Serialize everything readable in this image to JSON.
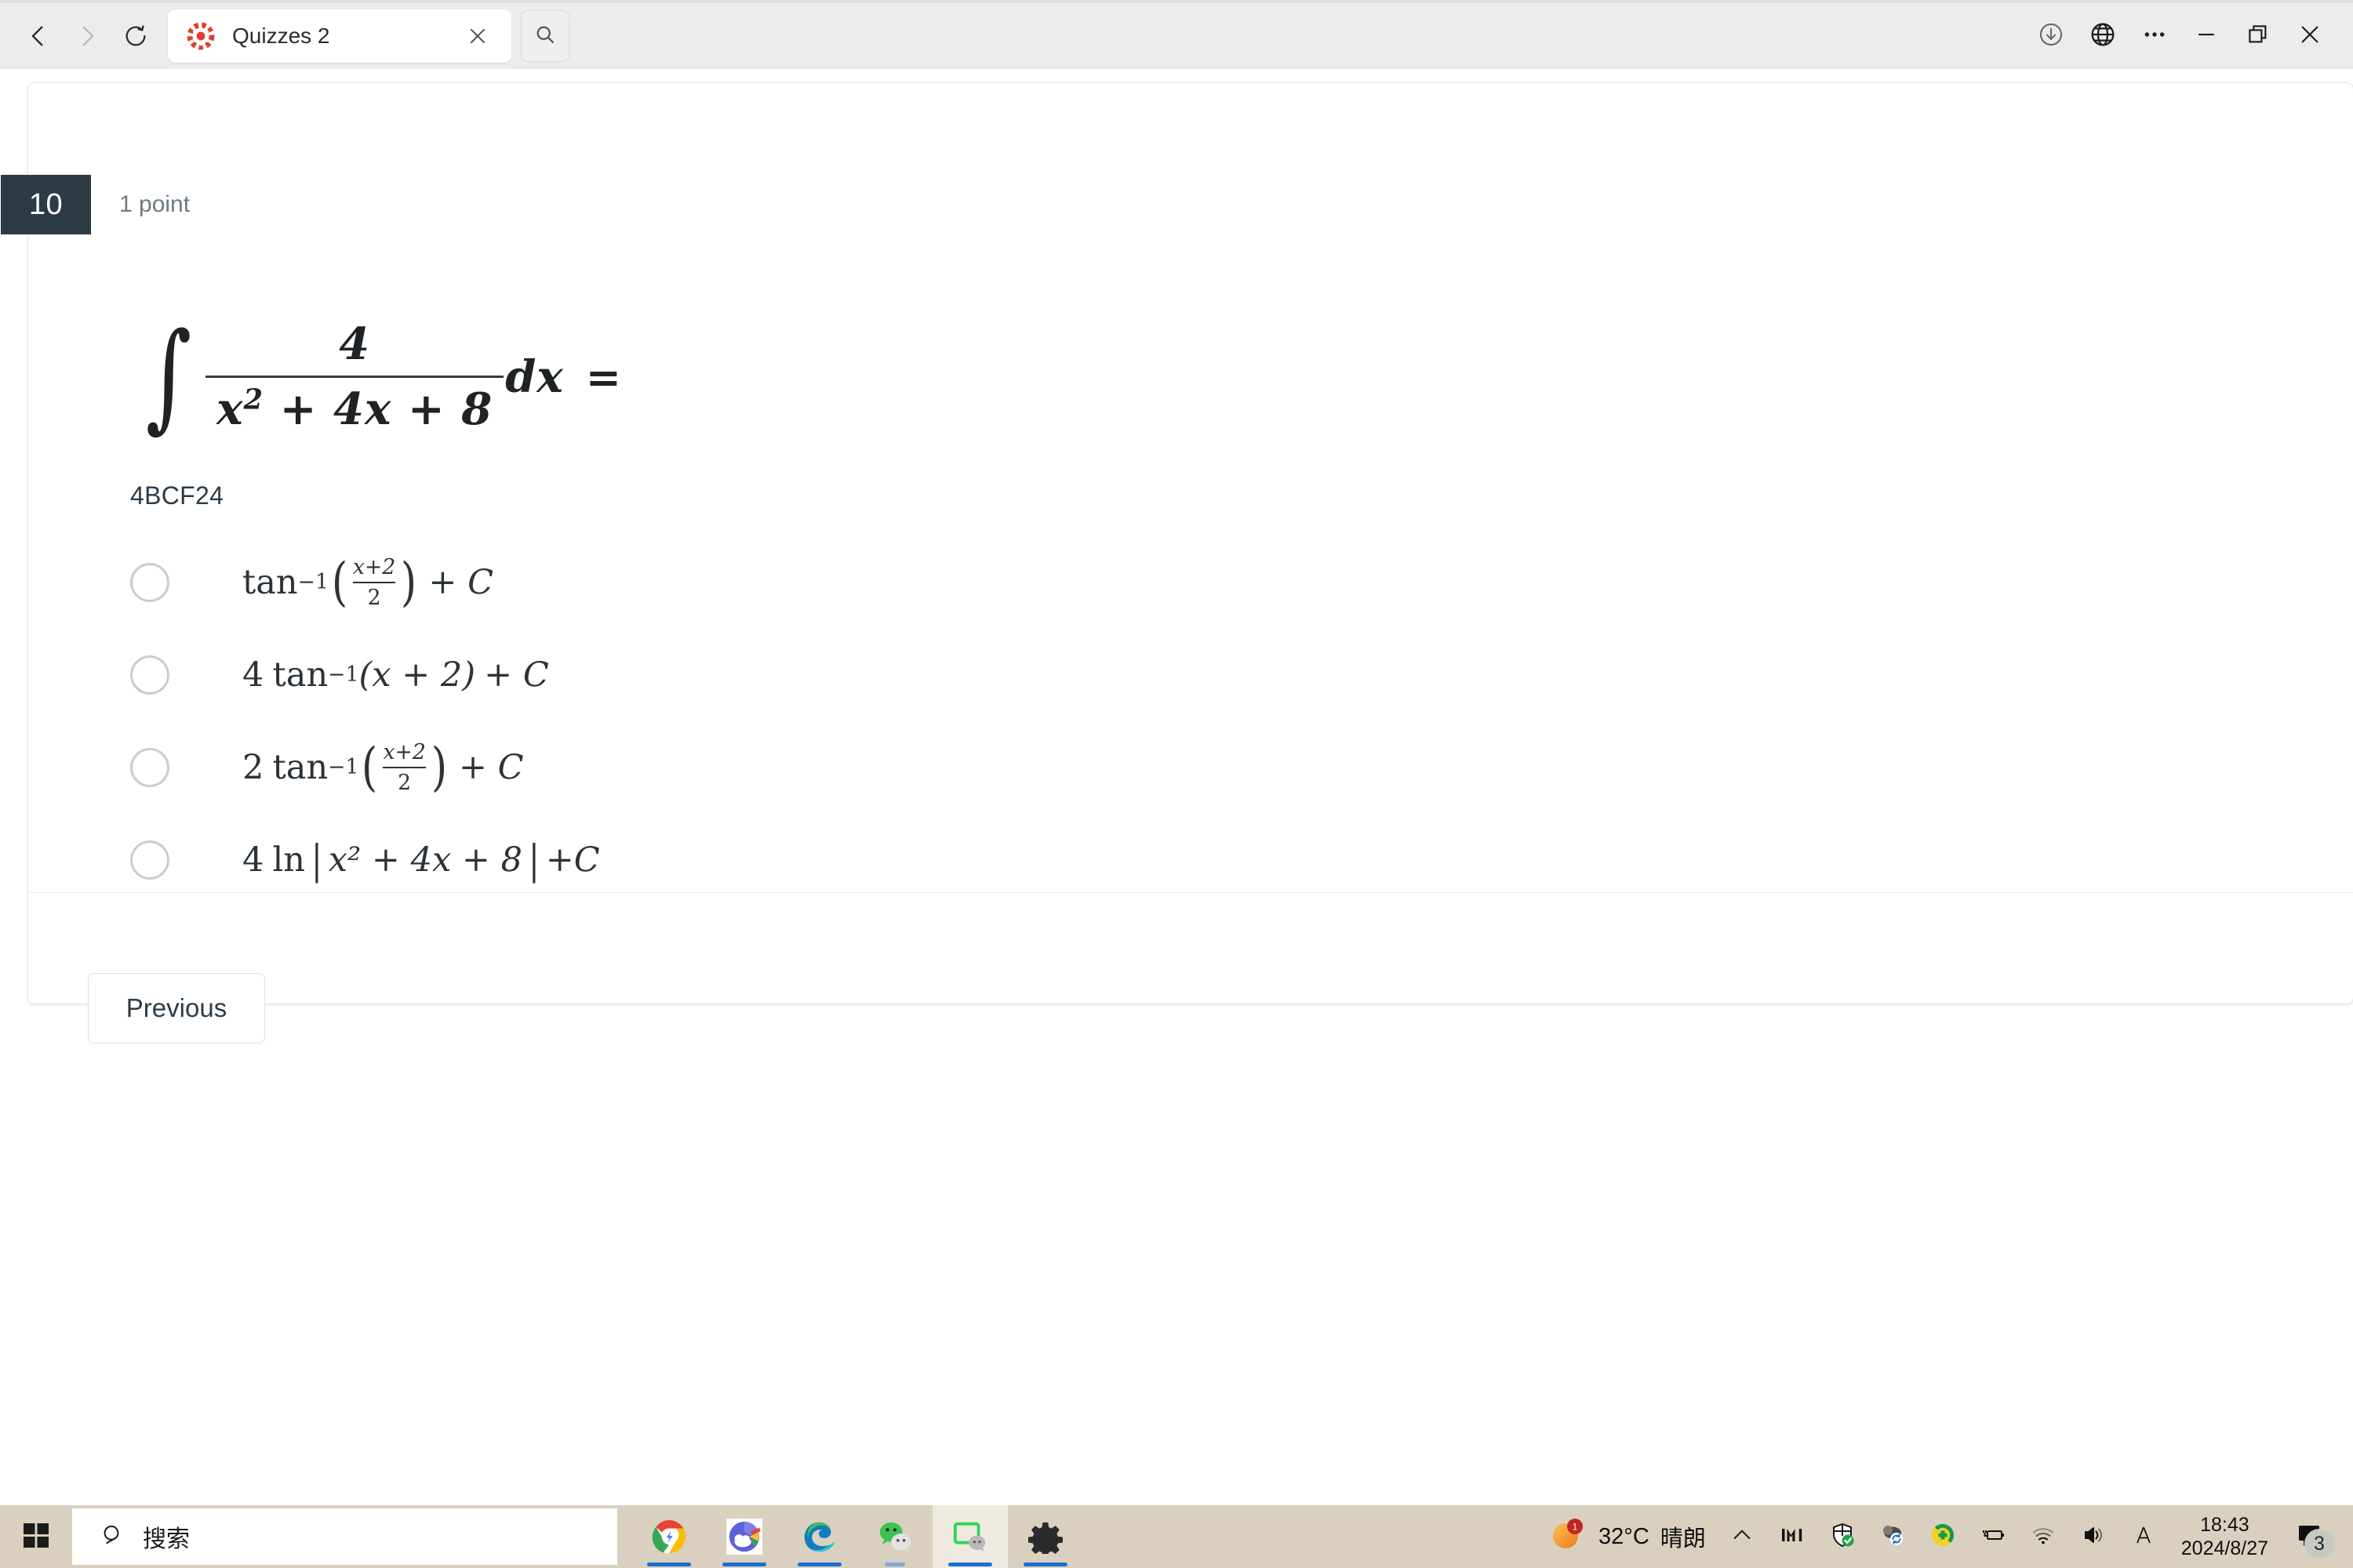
{
  "browser": {
    "nav": {
      "back_icon": "chevron-left-icon",
      "forward_icon": "chevron-right-icon",
      "reload_icon": "reload-icon"
    },
    "tab": {
      "title": "Quizzes 2",
      "favicon": "canvas-lms-icon",
      "close_icon": "close-icon"
    },
    "tab_search_icon": "search-icon",
    "window_controls": [
      {
        "name": "download-icon",
        "label": ""
      },
      {
        "name": "globe-icon",
        "label": ""
      },
      {
        "name": "more-options-icon",
        "label": ""
      },
      {
        "name": "minimize-icon",
        "label": ""
      },
      {
        "name": "restore-icon",
        "label": ""
      },
      {
        "name": "close-window-icon",
        "label": ""
      }
    ]
  },
  "quiz": {
    "question_number": "10",
    "points": "1 point",
    "formula": {
      "integral_sign": "∫",
      "numerator": "4",
      "denominator_base": "x",
      "denominator_exp": "2",
      "denominator_rest": " + 4x + 8",
      "differential": "dx",
      "equals": "="
    },
    "answer_code": "4BCF24",
    "options": [
      {
        "id": "option-a",
        "coefficient": "",
        "function": "tan",
        "exponent": "−1",
        "arg_num": "x+2",
        "arg_den": "2",
        "constant": "+ C",
        "selected": false
      },
      {
        "id": "option-b",
        "coefficient": "4",
        "function": "tan",
        "exponent": "−1",
        "arg_plain": "(x + 2)",
        "constant": "+ C",
        "selected": false
      },
      {
        "id": "option-c",
        "coefficient": "2",
        "function": "tan",
        "exponent": "−1",
        "arg_num": "x+2",
        "arg_den": "2",
        "constant": "+ C",
        "selected": false
      },
      {
        "id": "option-d",
        "coefficient": "4",
        "function": "ln",
        "arg_abs": "x² + 4x + 8",
        "constant": "+C",
        "selected": false
      }
    ],
    "previous_button": "Previous"
  },
  "taskbar": {
    "start_icon": "windows-start-icon",
    "search_placeholder": "搜索",
    "search_icon": "search-icon",
    "apps": [
      {
        "name": "chrome-icon",
        "active": false,
        "running": true
      },
      {
        "name": "weather-app-icon",
        "active": false,
        "running": true
      },
      {
        "name": "edge-icon",
        "active": false,
        "running": true
      },
      {
        "name": "wechat-icon",
        "active": false,
        "running": true
      },
      {
        "name": "wechat-desktop-icon",
        "active": true,
        "running": true
      },
      {
        "name": "settings-gear-icon",
        "active": false,
        "running": true
      }
    ],
    "weather": {
      "temperature": "32°C",
      "condition": "晴朗",
      "badge": "1",
      "icon": "sun-icon"
    },
    "tray_icons": [
      {
        "name": "show-hidden-icons-chevron"
      },
      {
        "name": "imi-input-icon"
      },
      {
        "name": "security-shield-icon"
      },
      {
        "name": "onedrive-sync-icon"
      },
      {
        "name": "antivirus-icon"
      },
      {
        "name": "battery-charging-icon"
      },
      {
        "name": "wifi-icon"
      },
      {
        "name": "volume-icon"
      },
      {
        "name": "ime-language-icon"
      }
    ],
    "clock": {
      "time": "18:43",
      "date": "2024/8/27"
    },
    "notifications": {
      "icon": "notification-icon",
      "count": "3"
    }
  },
  "colors": {
    "question_badge_bg": "#2d3b45",
    "text_dark": "#2d3b45",
    "text_muted": "#6d7a82",
    "chrome_bg": "#ececec",
    "taskbar_bg": "#d9d0bf",
    "canvas_red": "#e03e2d"
  }
}
